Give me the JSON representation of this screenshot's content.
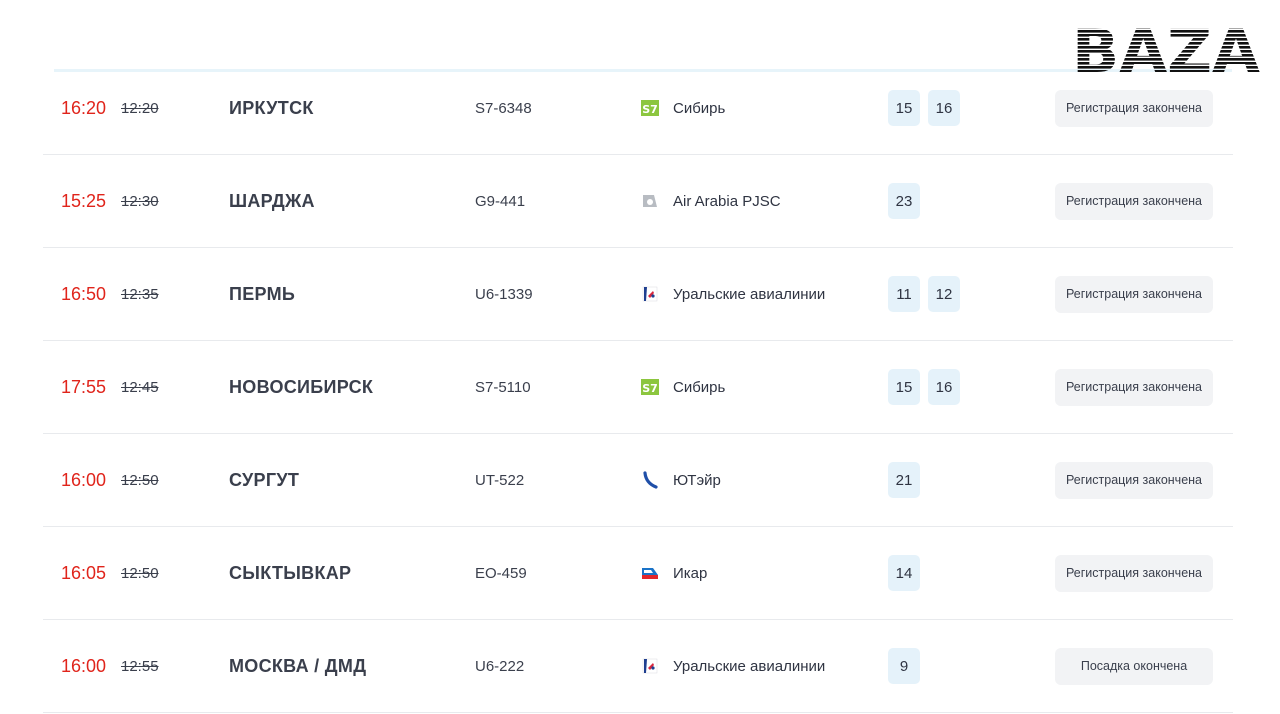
{
  "watermark": {
    "text": "BAZA"
  },
  "colors": {
    "delay_red": "#e0241b",
    "gate_bg": "#e5f2fa",
    "badge_bg": "#f2f3f5"
  },
  "flights": [
    {
      "time_new": "16:20",
      "time_old": "12:20",
      "city": "ИРКУТСК",
      "flight": "S7-6348",
      "airline": "Сибирь",
      "logo": "s7-logo-icon",
      "gates": [
        "15",
        "16"
      ],
      "status": "Регистрация закончена"
    },
    {
      "time_new": "15:25",
      "time_old": "12:30",
      "city": "ШАРДЖА",
      "flight": "G9-441",
      "airline": "Air Arabia PJSC",
      "logo": "air-arabia-logo-icon",
      "gates": [
        "23"
      ],
      "status": "Регистрация закончена"
    },
    {
      "time_new": "16:50",
      "time_old": "12:35",
      "city": "ПЕРМЬ",
      "flight": "U6-1339",
      "airline": "Уральские авиалинии",
      "logo": "ural-airlines-logo-icon",
      "gates": [
        "11",
        "12"
      ],
      "status": "Регистрация закончена"
    },
    {
      "time_new": "17:55",
      "time_old": "12:45",
      "city": "НОВОСИБИРСК",
      "flight": "S7-5110",
      "airline": "Сибирь",
      "logo": "s7-logo-icon",
      "gates": [
        "15",
        "16"
      ],
      "status": "Регистрация закончена"
    },
    {
      "time_new": "16:00",
      "time_old": "12:50",
      "city": "СУРГУТ",
      "flight": "UT-522",
      "airline": "ЮТэйр",
      "logo": "utair-logo-icon",
      "gates": [
        "21"
      ],
      "status": "Регистрация закончена"
    },
    {
      "time_new": "16:05",
      "time_old": "12:50",
      "city": "СЫКТЫВКАР",
      "flight": "EO-459",
      "airline": "Икар",
      "logo": "ikar-logo-icon",
      "gates": [
        "14"
      ],
      "status": "Регистрация закончена"
    },
    {
      "time_new": "16:00",
      "time_old": "12:55",
      "city": "МОСКВА / ДМД",
      "flight": "U6-222",
      "airline": "Уральские авиалинии",
      "logo": "ural-airlines-logo-icon",
      "gates": [
        "9"
      ],
      "status": "Посадка окончена"
    }
  ]
}
